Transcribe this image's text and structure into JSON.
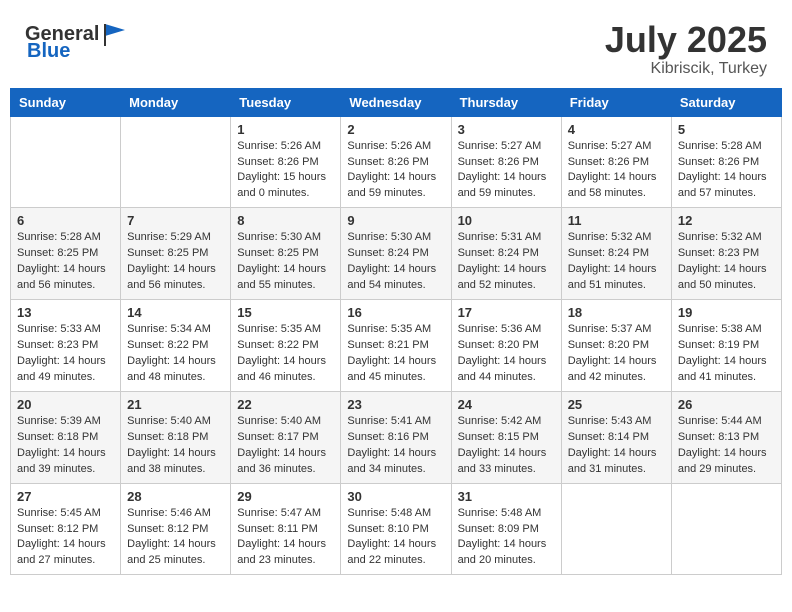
{
  "header": {
    "logo_general": "General",
    "logo_blue": "Blue",
    "month": "July 2025",
    "location": "Kibriscik, Turkey"
  },
  "weekdays": [
    "Sunday",
    "Monday",
    "Tuesday",
    "Wednesday",
    "Thursday",
    "Friday",
    "Saturday"
  ],
  "weeks": [
    [
      {
        "day": "",
        "sunrise": "",
        "sunset": "",
        "daylight": ""
      },
      {
        "day": "",
        "sunrise": "",
        "sunset": "",
        "daylight": ""
      },
      {
        "day": "1",
        "sunrise": "Sunrise: 5:26 AM",
        "sunset": "Sunset: 8:26 PM",
        "daylight": "Daylight: 15 hours and 0 minutes."
      },
      {
        "day": "2",
        "sunrise": "Sunrise: 5:26 AM",
        "sunset": "Sunset: 8:26 PM",
        "daylight": "Daylight: 14 hours and 59 minutes."
      },
      {
        "day": "3",
        "sunrise": "Sunrise: 5:27 AM",
        "sunset": "Sunset: 8:26 PM",
        "daylight": "Daylight: 14 hours and 59 minutes."
      },
      {
        "day": "4",
        "sunrise": "Sunrise: 5:27 AM",
        "sunset": "Sunset: 8:26 PM",
        "daylight": "Daylight: 14 hours and 58 minutes."
      },
      {
        "day": "5",
        "sunrise": "Sunrise: 5:28 AM",
        "sunset": "Sunset: 8:26 PM",
        "daylight": "Daylight: 14 hours and 57 minutes."
      }
    ],
    [
      {
        "day": "6",
        "sunrise": "Sunrise: 5:28 AM",
        "sunset": "Sunset: 8:25 PM",
        "daylight": "Daylight: 14 hours and 56 minutes."
      },
      {
        "day": "7",
        "sunrise": "Sunrise: 5:29 AM",
        "sunset": "Sunset: 8:25 PM",
        "daylight": "Daylight: 14 hours and 56 minutes."
      },
      {
        "day": "8",
        "sunrise": "Sunrise: 5:30 AM",
        "sunset": "Sunset: 8:25 PM",
        "daylight": "Daylight: 14 hours and 55 minutes."
      },
      {
        "day": "9",
        "sunrise": "Sunrise: 5:30 AM",
        "sunset": "Sunset: 8:24 PM",
        "daylight": "Daylight: 14 hours and 54 minutes."
      },
      {
        "day": "10",
        "sunrise": "Sunrise: 5:31 AM",
        "sunset": "Sunset: 8:24 PM",
        "daylight": "Daylight: 14 hours and 52 minutes."
      },
      {
        "day": "11",
        "sunrise": "Sunrise: 5:32 AM",
        "sunset": "Sunset: 8:24 PM",
        "daylight": "Daylight: 14 hours and 51 minutes."
      },
      {
        "day": "12",
        "sunrise": "Sunrise: 5:32 AM",
        "sunset": "Sunset: 8:23 PM",
        "daylight": "Daylight: 14 hours and 50 minutes."
      }
    ],
    [
      {
        "day": "13",
        "sunrise": "Sunrise: 5:33 AM",
        "sunset": "Sunset: 8:23 PM",
        "daylight": "Daylight: 14 hours and 49 minutes."
      },
      {
        "day": "14",
        "sunrise": "Sunrise: 5:34 AM",
        "sunset": "Sunset: 8:22 PM",
        "daylight": "Daylight: 14 hours and 48 minutes."
      },
      {
        "day": "15",
        "sunrise": "Sunrise: 5:35 AM",
        "sunset": "Sunset: 8:22 PM",
        "daylight": "Daylight: 14 hours and 46 minutes."
      },
      {
        "day": "16",
        "sunrise": "Sunrise: 5:35 AM",
        "sunset": "Sunset: 8:21 PM",
        "daylight": "Daylight: 14 hours and 45 minutes."
      },
      {
        "day": "17",
        "sunrise": "Sunrise: 5:36 AM",
        "sunset": "Sunset: 8:20 PM",
        "daylight": "Daylight: 14 hours and 44 minutes."
      },
      {
        "day": "18",
        "sunrise": "Sunrise: 5:37 AM",
        "sunset": "Sunset: 8:20 PM",
        "daylight": "Daylight: 14 hours and 42 minutes."
      },
      {
        "day": "19",
        "sunrise": "Sunrise: 5:38 AM",
        "sunset": "Sunset: 8:19 PM",
        "daylight": "Daylight: 14 hours and 41 minutes."
      }
    ],
    [
      {
        "day": "20",
        "sunrise": "Sunrise: 5:39 AM",
        "sunset": "Sunset: 8:18 PM",
        "daylight": "Daylight: 14 hours and 39 minutes."
      },
      {
        "day": "21",
        "sunrise": "Sunrise: 5:40 AM",
        "sunset": "Sunset: 8:18 PM",
        "daylight": "Daylight: 14 hours and 38 minutes."
      },
      {
        "day": "22",
        "sunrise": "Sunrise: 5:40 AM",
        "sunset": "Sunset: 8:17 PM",
        "daylight": "Daylight: 14 hours and 36 minutes."
      },
      {
        "day": "23",
        "sunrise": "Sunrise: 5:41 AM",
        "sunset": "Sunset: 8:16 PM",
        "daylight": "Daylight: 14 hours and 34 minutes."
      },
      {
        "day": "24",
        "sunrise": "Sunrise: 5:42 AM",
        "sunset": "Sunset: 8:15 PM",
        "daylight": "Daylight: 14 hours and 33 minutes."
      },
      {
        "day": "25",
        "sunrise": "Sunrise: 5:43 AM",
        "sunset": "Sunset: 8:14 PM",
        "daylight": "Daylight: 14 hours and 31 minutes."
      },
      {
        "day": "26",
        "sunrise": "Sunrise: 5:44 AM",
        "sunset": "Sunset: 8:13 PM",
        "daylight": "Daylight: 14 hours and 29 minutes."
      }
    ],
    [
      {
        "day": "27",
        "sunrise": "Sunrise: 5:45 AM",
        "sunset": "Sunset: 8:12 PM",
        "daylight": "Daylight: 14 hours and 27 minutes."
      },
      {
        "day": "28",
        "sunrise": "Sunrise: 5:46 AM",
        "sunset": "Sunset: 8:12 PM",
        "daylight": "Daylight: 14 hours and 25 minutes."
      },
      {
        "day": "29",
        "sunrise": "Sunrise: 5:47 AM",
        "sunset": "Sunset: 8:11 PM",
        "daylight": "Daylight: 14 hours and 23 minutes."
      },
      {
        "day": "30",
        "sunrise": "Sunrise: 5:48 AM",
        "sunset": "Sunset: 8:10 PM",
        "daylight": "Daylight: 14 hours and 22 minutes."
      },
      {
        "day": "31",
        "sunrise": "Sunrise: 5:48 AM",
        "sunset": "Sunset: 8:09 PM",
        "daylight": "Daylight: 14 hours and 20 minutes."
      },
      {
        "day": "",
        "sunrise": "",
        "sunset": "",
        "daylight": ""
      },
      {
        "day": "",
        "sunrise": "",
        "sunset": "",
        "daylight": ""
      }
    ]
  ]
}
